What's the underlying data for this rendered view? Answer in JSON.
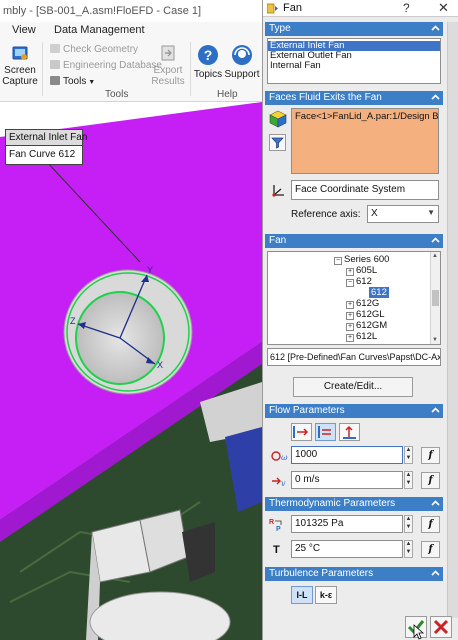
{
  "window": {
    "title": "mbly - [SB-001_A.asm!FloEFD - Case 1]"
  },
  "menubar": {
    "items": [
      "View",
      "Data Management"
    ]
  },
  "ribbon": {
    "screen_capture": "Screen Capture",
    "check_geometry": "Check Geometry",
    "engineering_database": "Engineering Database",
    "tools": "Tools",
    "export_results": "Export Results",
    "topics": "Topics",
    "support": "Support",
    "group_tools": "Tools",
    "group_help": "Help"
  },
  "callout": {
    "title": "External Inlet Fan",
    "value": "Fan Curve 612"
  },
  "axes": {
    "x": "X",
    "y": "Y",
    "z": "Z"
  },
  "panel": {
    "title": "Fan",
    "help": "?",
    "close": "✕",
    "type": {
      "header": "Type",
      "options": [
        "External Inlet Fan",
        "External Outlet Fan",
        "Internal Fan"
      ],
      "selected_index": 0
    },
    "faces": {
      "header": "Faces Fluid Exits the Fan",
      "face": "Face<1>FanLid_A.par:1/Design Body_1",
      "coordinate_system": "Face Coordinate System",
      "reference_axis_label": "Reference axis:",
      "reference_axis_value": "X"
    },
    "fan": {
      "header": "Fan",
      "tree": [
        {
          "label": "Series 600",
          "expander": "−"
        },
        {
          "label": "605L",
          "expander": "+"
        },
        {
          "label": "612",
          "expander": "−"
        },
        {
          "label": "612",
          "expander": ""
        },
        {
          "label": "612G",
          "expander": "+"
        },
        {
          "label": "612GL",
          "expander": "+"
        },
        {
          "label": "612GM",
          "expander": "+"
        },
        {
          "label": "612L",
          "expander": "+"
        }
      ],
      "selected_path": "612 [Pre-Defined\\Fan Curves\\Papst\\DC-Axial\\Series 600\\612]",
      "create_edit": "Create/Edit..."
    },
    "flow": {
      "header": "Flow Parameters",
      "speed_value": "1000",
      "velocity_value": "0 m/s",
      "fx": "f"
    },
    "thermo": {
      "header": "Thermodynamic Parameters",
      "pressure_value": "101325 Pa",
      "temperature_label": "T",
      "temperature_value": "25 °C",
      "fx": "f"
    },
    "turbulence": {
      "header": "Turbulence Parameters",
      "il_button": "I-L",
      "ke_button": "k-ε"
    }
  },
  "colors": {
    "section_header": "#3d7fc6",
    "face_selection": "#f4b07e",
    "model_magenta": "#c51ff5",
    "pcb_green": "#2f4f2f",
    "selection_ring": "#1fd14a",
    "ok": "#2b8a2b",
    "cancel": "#cc2222"
  }
}
